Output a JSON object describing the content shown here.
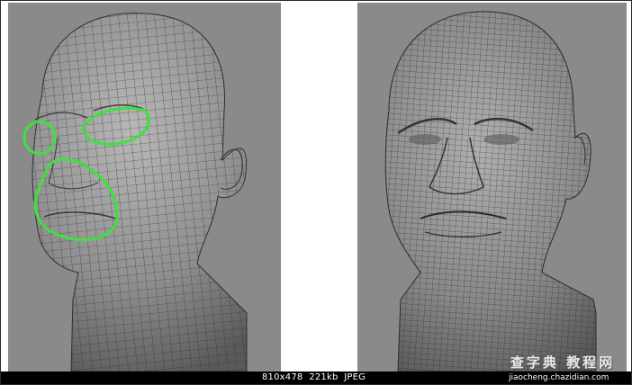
{
  "status_bar": {
    "dimensions": "810x478",
    "file_size": "221kb",
    "format": "JPEG"
  },
  "watermark": {
    "title": "查字典 教程网",
    "url": "jiaocheng.chazidian.com"
  },
  "panels": {
    "left": {
      "description": "3D head wireframe with green topology annotations"
    },
    "right": {
      "description": "Detailed 3D head wireframe"
    }
  },
  "colors": {
    "panel_background": "#8a8a8a",
    "annotation": "#3fe03f",
    "status_bar": "#000000"
  },
  "icons": [
    "head-model-left-image",
    "head-model-right-image"
  ]
}
